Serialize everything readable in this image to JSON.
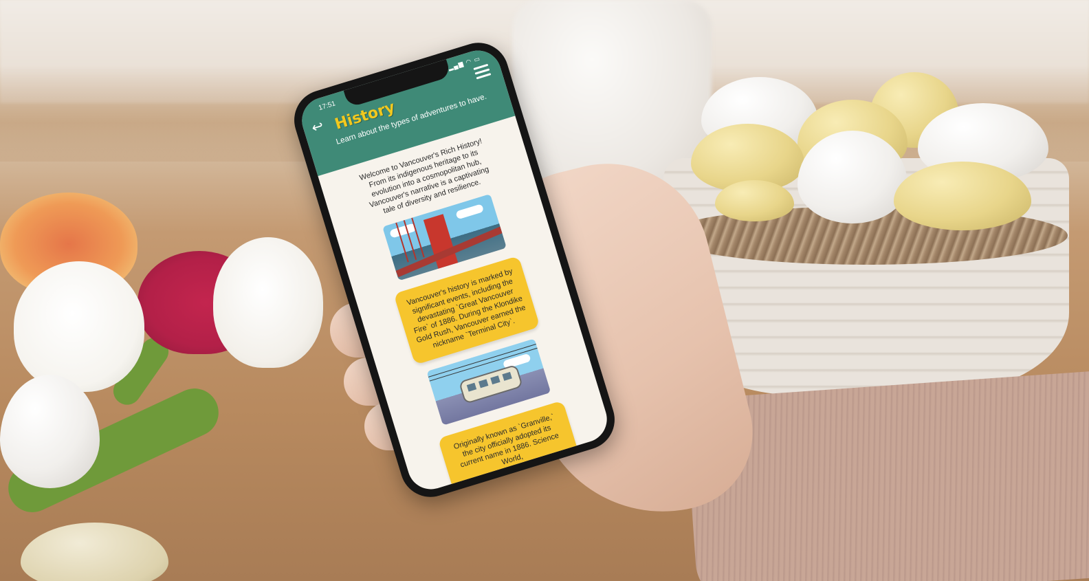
{
  "status_bar": {
    "time": "17:51"
  },
  "header": {
    "title": "History",
    "subtitle": "Learn about the types of adventures to have."
  },
  "content": {
    "intro": "Welcome to Vancouver's Rich History! From its indigenous heritage to its evolution into a cosmopolitan hub, Vancouver's narrative is a captivating tale of diversity and resilience.",
    "callout_1": "Vancouver's history is marked by significant events, including the devastating `Great Vancouver Fire` of 1886. During the Klondike Gold Rush, Vancouver earned the nickname `Terminal City`.",
    "callout_2": "Originally known as `Granville,` the city officially adopted its current name in 1886. Science World,"
  },
  "icons": {
    "back": "back-arrow-icon",
    "menu": "hamburger-menu-icon",
    "signal": "signal-icon",
    "wifi": "wifi-icon",
    "battery": "battery-icon"
  },
  "colors": {
    "header_bg": "#3f8a77",
    "title": "#f2c81e",
    "callout_bg": "#f6c52d",
    "screen_bg": "#f7f3ec"
  }
}
